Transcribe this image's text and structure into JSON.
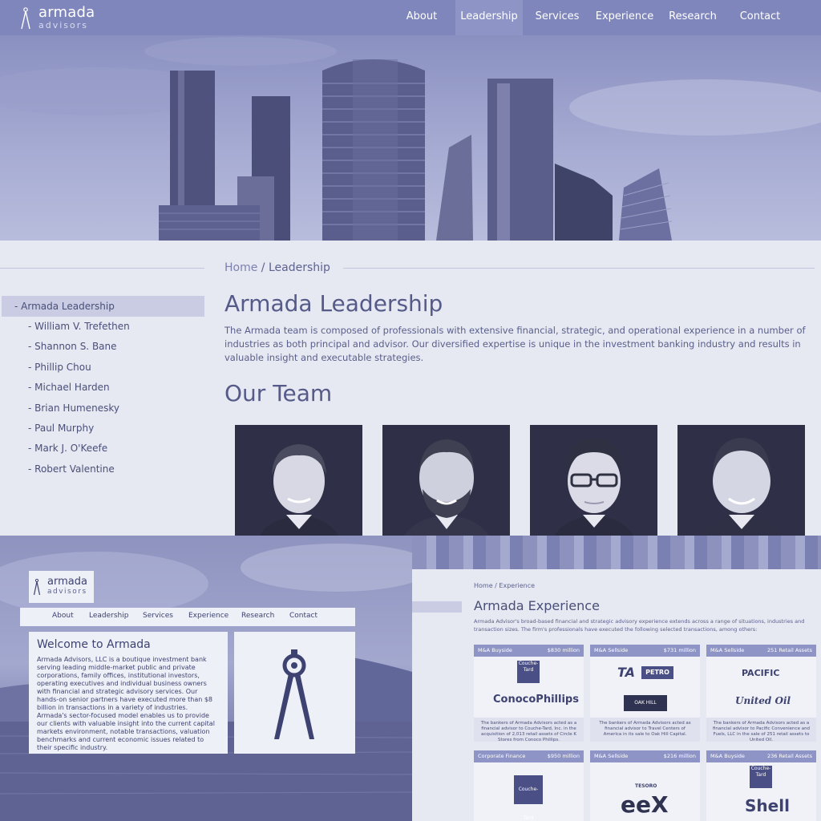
{
  "header": {
    "logo": {
      "name": "armada",
      "tagline": "advisors"
    },
    "nav": [
      {
        "label": "About"
      },
      {
        "label": "Leadership"
      },
      {
        "label": "Services"
      },
      {
        "label": "Experience"
      },
      {
        "label": "Research"
      },
      {
        "label": "Contact"
      }
    ],
    "active_nav": "Leadership"
  },
  "breadcrumb": {
    "home": "Home",
    "separator": "/",
    "current": "Leadership"
  },
  "sidebar": {
    "active": "- Armada Leadership",
    "items": [
      {
        "label": "- William V. Trefethen"
      },
      {
        "label": "- Shannon S. Bane"
      },
      {
        "label": "- Phillip Chou"
      },
      {
        "label": "- Michael Harden"
      },
      {
        "label": "- Brian Humenesky"
      },
      {
        "label": "- Paul Murphy"
      },
      {
        "label": "- Mark J. O'Keefe"
      },
      {
        "label": "- Robert Valentine"
      }
    ]
  },
  "main": {
    "title": "Armada Leadership",
    "intro": "The Armada team is composed of professionals with extensive financial, strategic, and operational experience in a number of industries as both principal and advisor. Our diversified expertise is unique in the investment banking industry and results in valuable insight and executable strategies.",
    "team_heading": "Our Team"
  },
  "inset_home": {
    "logo": {
      "name": "armada",
      "tagline": "advisors"
    },
    "nav": [
      "About",
      "Leadership",
      "Services",
      "Experience",
      "Research",
      "Contact"
    ],
    "welcome_title": "Welcome to Armada",
    "welcome_text": "Armada Advisors, LLC is a boutique investment bank serving leading middle-market public and private corporations, family offices, institutional investors, operating executives and individual business owners with financial and strategic advisory services. Our hands-on senior partners have executed more than $8 billion in transactions in a variety of industries. Armada's sector-focused model enables us to provide our clients with valuable insight into the current capital markets environment, notable transactions, valuation benchmarks and current economic issues related to their specific industry."
  },
  "inset_experience": {
    "breadcrumb": "Home / Experience",
    "title": "Armada Experience",
    "intro": "Armada Advisor's broad-based financial and strategic advisory experience extends across a range of situations, industries and transaction sizes. The firm's professionals have executed the following selected transactions, among others:",
    "cards": [
      {
        "type": "M&A Buyside",
        "value": "$830 million",
        "logos": [
          "Couche-Tard",
          "ConocoPhillips"
        ],
        "caption": "The bankers of Armada Advisors acted as a financial advisor to Couche-Tard, Inc. in the acquisition of 2,013 retail assets of Circle K Stores from Conoco Phillips."
      },
      {
        "type": "M&A Sellside",
        "value": "$731 million",
        "logos": [
          "TA",
          "PETRO",
          "OAK HILL"
        ],
        "caption": "The bankers of Armada Advisors acted as financial advisor to Travel Centers of America in its sale to Oak Hill Capital."
      },
      {
        "type": "M&A Sellside",
        "value": "251 Retail Assets",
        "logos": [
          "PACIFIC",
          "United Oil"
        ],
        "caption": "The bankers of Armada Advisors acted as a financial advisor to Pacific Convenience and Fuels, LLC in the sale of 251 retail assets to United Oil."
      },
      {
        "type": "Corporate Finance",
        "value": "$950 million",
        "logos": [
          "Couche-Tard"
        ]
      },
      {
        "type": "M&A Sellside",
        "value": "$216 million",
        "logos": [
          "TESORO",
          "eeX"
        ]
      },
      {
        "type": "M&A Buyside",
        "value": "236 Retail Assets",
        "logos": [
          "Couche-Tard",
          "Shell"
        ]
      }
    ]
  },
  "colors": {
    "nav_bg": "#7f86bb",
    "nav_active": "#8e95c6",
    "page_bg": "#e6e8f2",
    "text": "#4a4f78",
    "sidebar_active": "#c9cce2"
  }
}
